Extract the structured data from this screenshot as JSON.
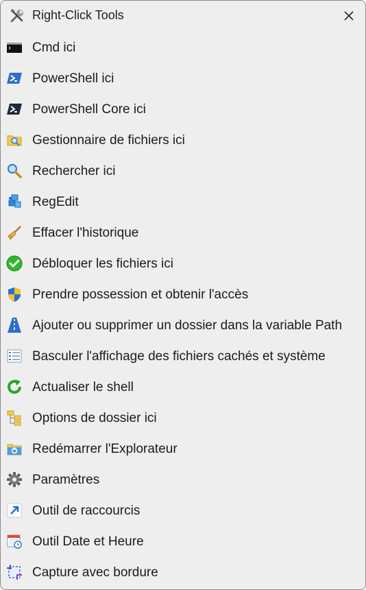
{
  "window": {
    "title": "Right-Click Tools",
    "title_icon": "tools-icon",
    "close_icon": "close-icon"
  },
  "menu": {
    "items": [
      {
        "label": "Cmd ici",
        "icon": "cmd-icon"
      },
      {
        "label": "PowerShell ici",
        "icon": "powershell-icon"
      },
      {
        "label": "PowerShell Core ici",
        "icon": "powershell-core-icon"
      },
      {
        "label": "Gestionnaire de fichiers ici",
        "icon": "file-manager-icon"
      },
      {
        "label": "Rechercher ici",
        "icon": "search-icon"
      },
      {
        "label": "RegEdit",
        "icon": "regedit-icon"
      },
      {
        "label": "Effacer l'historique",
        "icon": "broom-icon"
      },
      {
        "label": "Débloquer les fichiers ici",
        "icon": "check-icon"
      },
      {
        "label": "Prendre possession et obtenir l'accès",
        "icon": "shield-icon"
      },
      {
        "label": "Ajouter ou supprimer un dossier dans la variable Path",
        "icon": "path-road-icon"
      },
      {
        "label": "Basculer l'affichage des fichiers cachés et système",
        "icon": "list-icon"
      },
      {
        "label": "Actualiser le shell",
        "icon": "refresh-icon"
      },
      {
        "label": "Options de dossier ici",
        "icon": "folder-options-icon"
      },
      {
        "label": "Redémarrer l'Explorateur",
        "icon": "restart-explorer-icon"
      },
      {
        "label": "Paramètres",
        "icon": "gear-icon"
      },
      {
        "label": "Outil de raccourcis",
        "icon": "shortcut-arrow-icon"
      },
      {
        "label": "Outil Date et Heure",
        "icon": "calendar-clock-icon"
      },
      {
        "label": "Capture avec bordure",
        "icon": "capture-icon"
      }
    ]
  },
  "colors": {
    "background": "#eeeeee",
    "text": "#1b1b1b",
    "border": "#8a8a8a"
  }
}
